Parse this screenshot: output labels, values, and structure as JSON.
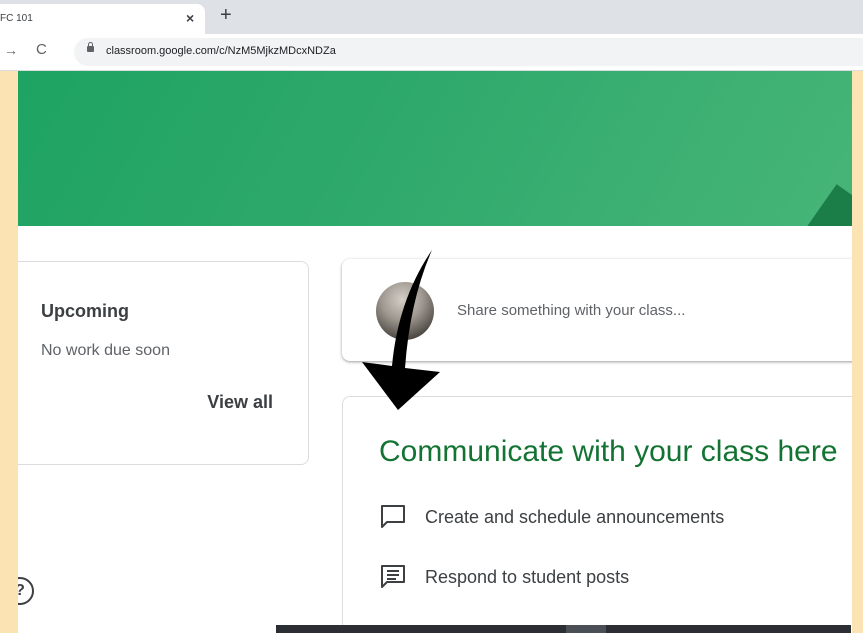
{
  "browser": {
    "tab_title": "FC 101",
    "tab_close": "×",
    "new_tab": "+",
    "nav_forward": "→",
    "nav_reload": "C",
    "url": "classroom.google.com/c/NzM5MjkzMDcxNDZa"
  },
  "sidebar": {
    "upcoming_title": "Upcoming",
    "upcoming_empty": "No work due soon",
    "view_all": "View all",
    "help_icon": "?"
  },
  "stream": {
    "share_placeholder": "Share something with your class...",
    "communicate_title": "Communicate with your class here",
    "items": [
      {
        "icon": "announcement-icon",
        "label": "Create and schedule announcements"
      },
      {
        "icon": "student-posts-icon",
        "label": "Respond to student posts"
      }
    ]
  },
  "colors": {
    "banner": "#2fa96c",
    "accent_green": "#137333",
    "page_border": "#fbe3b4"
  }
}
